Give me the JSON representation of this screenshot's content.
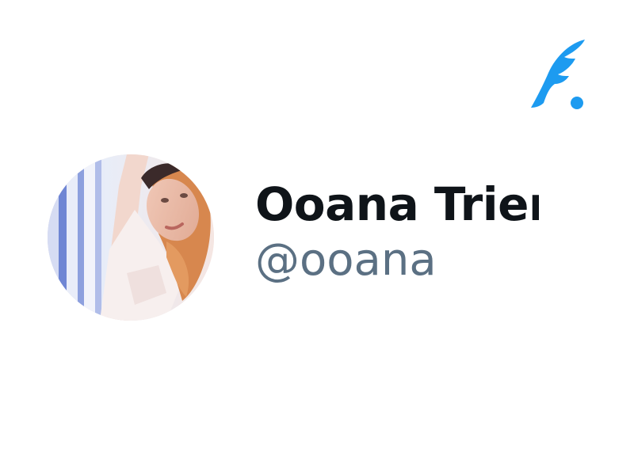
{
  "app": {
    "logo_icon": "quill-feather-icon",
    "accent_color": "#1d9bf0"
  },
  "profile": {
    "avatar_icon": "profile-photo",
    "display_name": "Ooana Trier",
    "handle": "@ooana"
  },
  "colors": {
    "name": "#0f1419",
    "handle": "#5b7083",
    "background": "#ffffff"
  }
}
